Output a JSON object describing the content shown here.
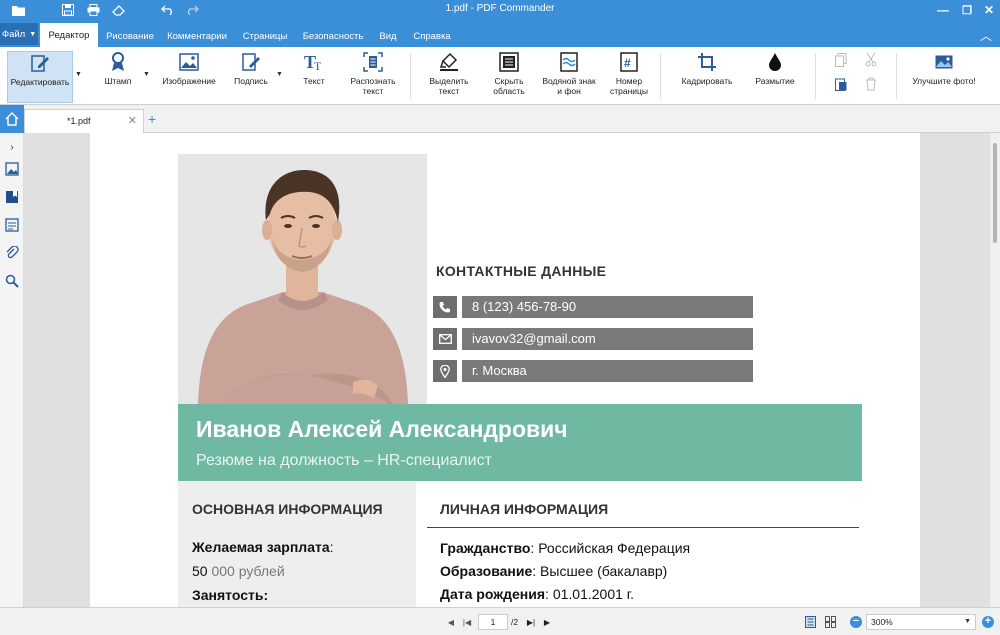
{
  "titlebar": {
    "title": "1.pdf - PDF Commander"
  },
  "tabs": {
    "file_label": "Файл",
    "items": [
      "Редактор",
      "Рисование",
      "Комментарии",
      "Страницы",
      "Безопасность",
      "Вид",
      "Справка"
    ],
    "active": "Редактор"
  },
  "ribbon": {
    "edit": "Редактировать",
    "stamp": "Штамп",
    "image": "Изображение",
    "signature": "Подпись",
    "text": "Текст",
    "ocr": "Распознать текст",
    "highlight": "Выделить текст",
    "hide_area": "Скрыть область",
    "watermark": "Водяной знак и фон",
    "page_number": "Номер страницы",
    "crop": "Кадрировать",
    "blur": "Размытие",
    "enhance": "Улучшите фото!"
  },
  "doc": {
    "tab_name": "*1.pdf"
  },
  "resume": {
    "contacts_heading": "КОНТАКТНЫЕ ДАННЫЕ",
    "phone": "8 (123) 456-78-90",
    "email": "ivavov32@gmail.com",
    "city": "г. Москва",
    "name": "Иванов Алексей Александрович",
    "subtitle": "Резюме на должность – HR-специалист",
    "basic_heading": "ОСНОВНАЯ ИНФОРМАЦИЯ",
    "salary_label": "Желаемая зарплата",
    "salary_colon": ":",
    "salary_value": "50",
    "salary_unit": " 000 рублей",
    "employment_label": "Занятость:",
    "personal_heading": "ЛИЧНАЯ ИНФОРМАЦИЯ",
    "citizenship_label": "Гражданство",
    "citizenship_value": ": Российская Федерация",
    "education_label": "Образование",
    "education_value": ": Высшее (бакалавр)",
    "birth_label": "Дата рождения",
    "birth_value": ": 01.01.2001 г."
  },
  "status": {
    "page_current": "1",
    "page_total": "/2",
    "zoom": "300%"
  },
  "colors": {
    "accent": "#3a8fd8",
    "banner": "#6fb9a3",
    "contact_bar": "#7a7a7a"
  }
}
